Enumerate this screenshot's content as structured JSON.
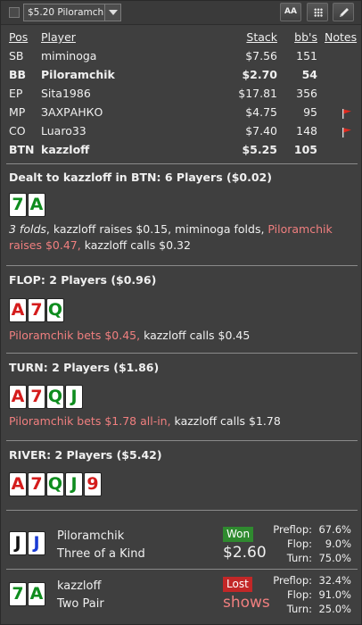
{
  "toolbar": {
    "selected_table": "$5.20 Piloramchik",
    "font_button_label": "AA",
    "grid_icon": "grid-icon",
    "edit_icon": "pencil-icon"
  },
  "players_table": {
    "headers": {
      "pos": "Pos",
      "player": "Player",
      "stack": "Stack",
      "bbs": "bb's",
      "notes": "Notes"
    },
    "rows": [
      {
        "pos": "SB",
        "player": "miminoga",
        "stack": "$7.56",
        "bbs": "151",
        "bold": false,
        "flag": false
      },
      {
        "pos": "BB",
        "player": "Piloramchik",
        "stack": "$2.70",
        "bbs": "54",
        "bold": true,
        "flag": false
      },
      {
        "pos": "EP",
        "player": "Sita1986",
        "stack": "$17.81",
        "bbs": "356",
        "bold": false,
        "flag": false
      },
      {
        "pos": "MP",
        "player": "ЗАХРАНКО",
        "stack": "$4.75",
        "bbs": "95",
        "bold": false,
        "flag": true
      },
      {
        "pos": "CO",
        "player": "Luaro33",
        "stack": "$7.40",
        "bbs": "148",
        "bold": false,
        "flag": true
      },
      {
        "pos": "BTN",
        "player": "kazzloff",
        "stack": "$5.25",
        "bbs": "105",
        "bold": true,
        "flag": false
      }
    ]
  },
  "preflop": {
    "title": "Dealt to kazzloff in BTN: 6 Players ($0.02)",
    "cards": [
      {
        "rank": "7",
        "suit": "c"
      },
      {
        "rank": "A",
        "suit": "c"
      }
    ],
    "a_folds": "3 folds",
    "a_raise": ", kazzloff raises $0.15, miminoga folds, ",
    "a_red": "Piloramchik raises $0.47,",
    "a_call": " kazzloff calls $0.32"
  },
  "flop": {
    "title": "FLOP: 2 Players ($0.96)",
    "cards": [
      {
        "rank": "A",
        "suit": "h"
      },
      {
        "rank": "7",
        "suit": "h"
      },
      {
        "rank": "Q",
        "suit": "c"
      }
    ],
    "a_red": "Piloramchik bets $0.45,",
    "a_call": " kazzloff calls $0.45"
  },
  "turn": {
    "title": "TURN: 2 Players ($1.86)",
    "cards": [
      {
        "rank": "A",
        "suit": "h"
      },
      {
        "rank": "7",
        "suit": "h"
      },
      {
        "rank": "Q",
        "suit": "c"
      },
      {
        "rank": "J",
        "suit": "c"
      }
    ],
    "a_red": "Piloramchik bets $1.78 all-in,",
    "a_call": " kazzloff calls $1.78"
  },
  "river": {
    "title": "RIVER: 2 Players ($5.42)",
    "cards": [
      {
        "rank": "A",
        "suit": "h"
      },
      {
        "rank": "7",
        "suit": "h"
      },
      {
        "rank": "Q",
        "suit": "c"
      },
      {
        "rank": "J",
        "suit": "c"
      },
      {
        "rank": "9",
        "suit": "h"
      }
    ]
  },
  "results": [
    {
      "name": "Piloramchik",
      "hand": "Three of a Kind",
      "cards": [
        {
          "rank": "J",
          "suit": "s"
        },
        {
          "rank": "J",
          "suit": "d"
        }
      ],
      "badge": "Won",
      "amount": "$2.60",
      "equity": {
        "preflop_label": "Preflop:",
        "preflop": "67.6%",
        "flop_label": "Flop:",
        "flop": "9.0%",
        "turn_label": "Turn:",
        "turn": "75.0%"
      }
    },
    {
      "name": "kazzloff",
      "hand": "Two Pair",
      "cards": [
        {
          "rank": "7",
          "suit": "c"
        },
        {
          "rank": "A",
          "suit": "c"
        }
      ],
      "badge": "Lost",
      "amount": "shows",
      "equity": {
        "preflop_label": "Preflop:",
        "preflop": "32.4%",
        "flop_label": "Flop:",
        "flop": "91.0%",
        "turn_label": "Turn:",
        "turn": "25.0%"
      }
    }
  ],
  "colors": {
    "background": "#3f3f3f",
    "accent_red": "#f07f7f",
    "won": "#2f8a2f",
    "lost": "#c22727",
    "club": "#0e8c1e",
    "diamond": "#1a3bd4",
    "heart": "#d41c1c",
    "spade": "#111111"
  }
}
